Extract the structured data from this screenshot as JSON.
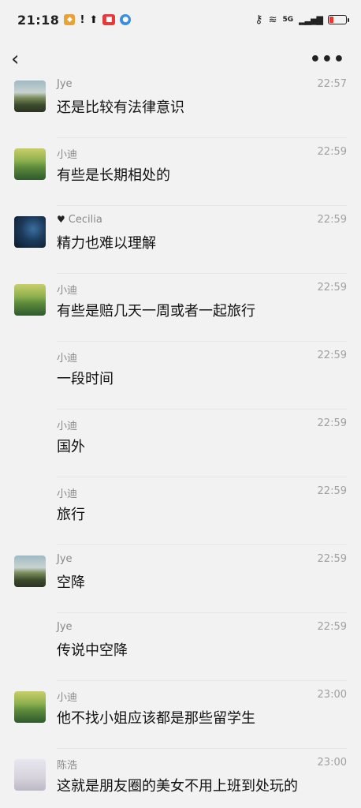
{
  "status_bar": {
    "time": "21:18",
    "network": "5G",
    "icons": [
      "shield-icon",
      "alert-icon",
      "upload-icon",
      "app-badge-icon",
      "globe-icon",
      "key-icon",
      "wifi-icon",
      "signal-icon",
      "battery-icon"
    ]
  },
  "navbar": {
    "back": "‹",
    "more": "•••"
  },
  "messages": [
    {
      "name": "Jye",
      "time": "22:57",
      "text": "还是比较有法律意识",
      "avatar": "landscape-avatar"
    },
    {
      "name": "小迪",
      "time": "22:59",
      "text": "有些是长期相处的",
      "avatar": "green-landscape-avatar"
    },
    {
      "name": "Cecilia",
      "time": "22:59",
      "text": "精力也难以理解",
      "avatar": "dark-water-avatar",
      "prefix": "black-heart-icon"
    },
    {
      "name": "小迪",
      "time": "22:59",
      "text": "有些是赔几天一周或者一起旅行",
      "avatar": "green-landscape-avatar"
    },
    {
      "name": "小迪",
      "time": "22:59",
      "text": "一段时间"
    },
    {
      "name": "小迪",
      "time": "22:59",
      "text": "国外"
    },
    {
      "name": "小迪",
      "time": "22:59",
      "text": "旅行"
    },
    {
      "name": "Jye",
      "time": "22:59",
      "text": "空降",
      "avatar": "landscape-avatar"
    },
    {
      "name": "Jye",
      "time": "22:59",
      "text": "传说中空降"
    },
    {
      "name": "小迪",
      "time": "23:00",
      "text": "他不找小姐应该都是那些留学生",
      "avatar": "green-landscape-avatar"
    },
    {
      "name": "陈浩",
      "time": "23:00",
      "text": "这就是朋友圈的美女不用上班到处玩的",
      "avatar": "person-avatar"
    }
  ]
}
